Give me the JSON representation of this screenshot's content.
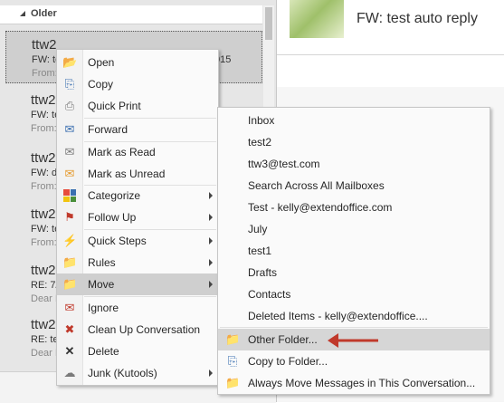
{
  "mail_list": {
    "group_label": "Older",
    "items": [
      {
        "sender": "ttw2",
        "subject": "FW: te",
        "date": "015",
        "preview": "From:"
      },
      {
        "sender": "ttw2",
        "subject": "FW: te",
        "preview": "From:"
      },
      {
        "sender": "ttw2",
        "subject": "FW: d",
        "preview": "From:"
      },
      {
        "sender": "ttw2",
        "subject": "FW: te",
        "preview": "From:"
      },
      {
        "sender": "ttw2",
        "subject": "RE: 7/",
        "preview": "Dear I"
      },
      {
        "sender": "ttw2",
        "subject": "RE: te",
        "preview": "Dear I"
      }
    ]
  },
  "reading_pane": {
    "title": "FW: test auto reply"
  },
  "context_menu": {
    "items": [
      {
        "label": "Open",
        "icon": "folder-open-icon"
      },
      {
        "label": "Copy",
        "icon": "copy-icon"
      },
      {
        "label": "Quick Print",
        "icon": "print-icon"
      },
      {
        "label": "Forward",
        "icon": "forward-icon"
      },
      {
        "label": "Mark as Read",
        "icon": "envelope-open-icon"
      },
      {
        "label": "Mark as Unread",
        "icon": "envelope-icon"
      },
      {
        "label": "Categorize",
        "icon": "categorize-icon"
      },
      {
        "label": "Follow Up",
        "icon": "flag-icon"
      },
      {
        "label": "Quick Steps",
        "icon": "lightning-icon"
      },
      {
        "label": "Rules",
        "icon": "rules-icon"
      },
      {
        "label": "Move",
        "icon": "move-folder-icon"
      },
      {
        "label": "Ignore",
        "icon": "ignore-icon"
      },
      {
        "label": "Clean Up Conversation",
        "icon": "cleanup-icon"
      },
      {
        "label": "Delete",
        "icon": "delete-x-icon"
      },
      {
        "label": "Junk (Kutools)",
        "icon": "junk-icon"
      }
    ]
  },
  "move_submenu": {
    "folders": [
      "Inbox",
      "test2",
      "ttw3@test.com",
      "Search Across All Mailboxes",
      "Test - kelly@extendoffice.com",
      "July",
      "test1",
      "Drafts",
      "Contacts",
      "Deleted Items - kelly@extendoffice...."
    ],
    "other_folder": "Other Folder...",
    "copy_to_folder": "Copy to Folder...",
    "always_move": "Always Move Messages in This Conversation..."
  },
  "colors": {
    "highlight": "#cfcfcf",
    "arrow": "#c0392b"
  }
}
